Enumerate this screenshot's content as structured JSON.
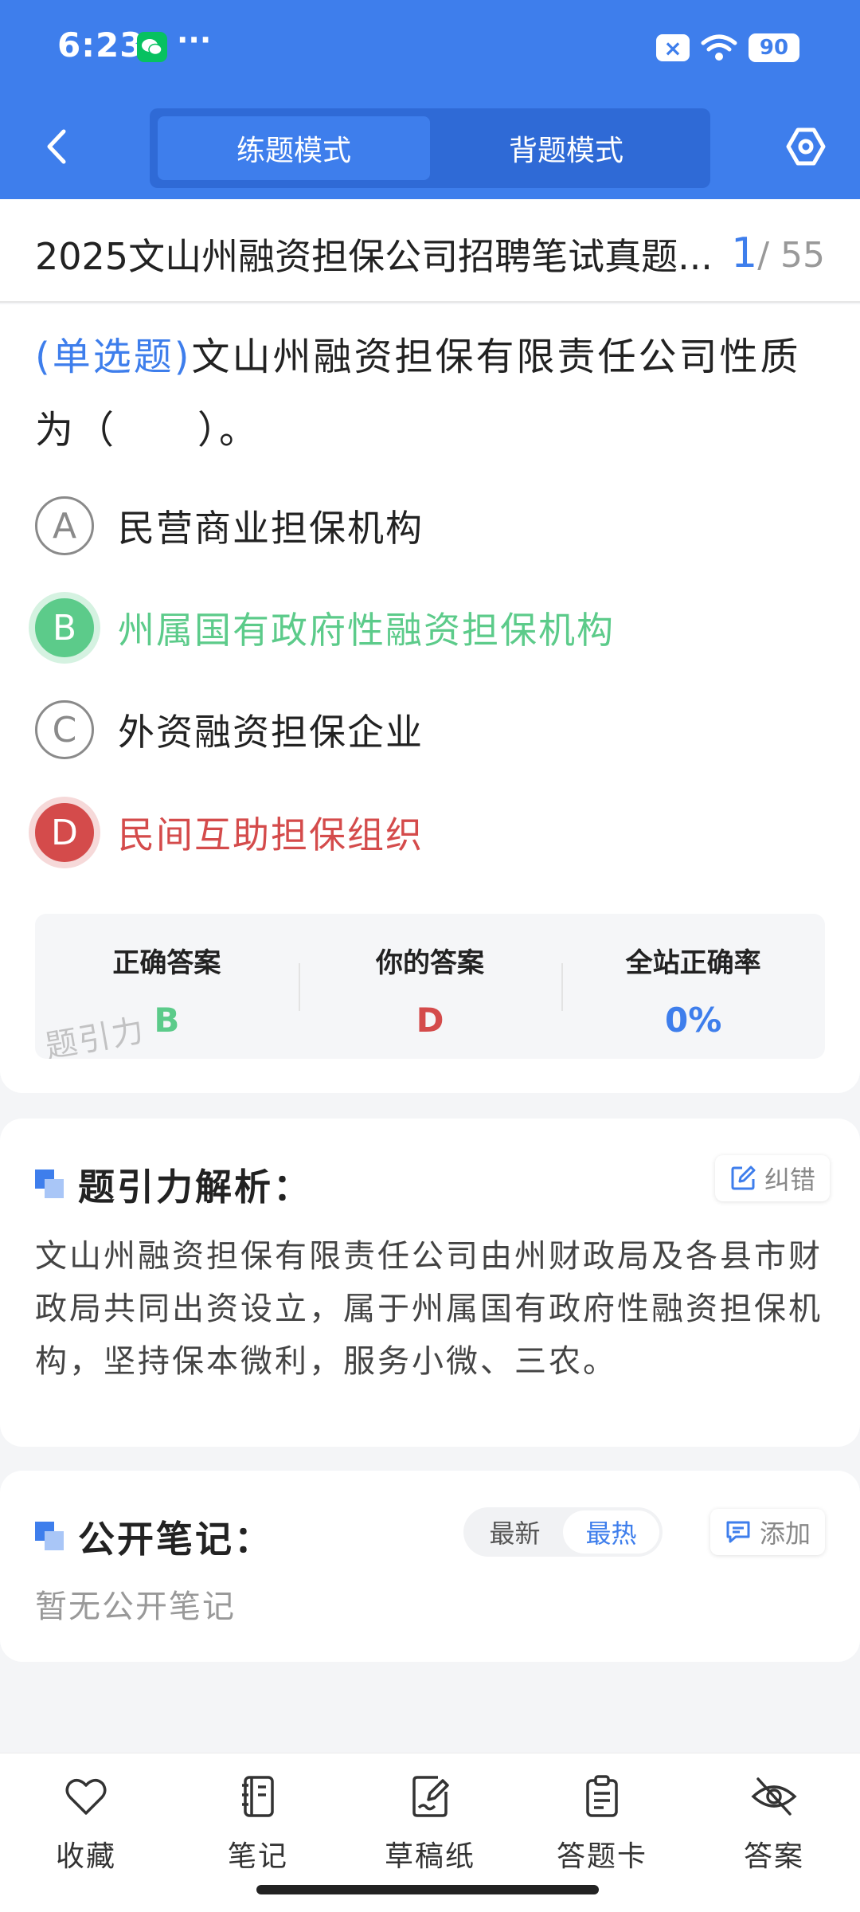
{
  "status_bar": {
    "time": "6:23",
    "more": "···",
    "sim_badge": "×",
    "battery": "90"
  },
  "nav": {
    "modes": [
      {
        "label": "练题模式",
        "active": true
      },
      {
        "label": "背题模式",
        "active": false
      }
    ]
  },
  "title_bar": {
    "title": "2025文山州融资担保公司招聘笔试真题...",
    "current": "1",
    "total": "/ 55"
  },
  "question": {
    "type_label": "(单选题)",
    "text": "文山州融资担保有限责任公司性质为（　　）。",
    "options": [
      {
        "letter": "A",
        "text": "民营商业担保机构",
        "state": "normal"
      },
      {
        "letter": "B",
        "text": "州属国有政府性融资担保机构",
        "state": "correct"
      },
      {
        "letter": "C",
        "text": "外资融资担保企业",
        "state": "normal"
      },
      {
        "letter": "D",
        "text": "民间互助担保组织",
        "state": "wrong"
      }
    ]
  },
  "answer_summary": {
    "correct_label": "正确答案",
    "correct_value": "B",
    "yours_label": "你的答案",
    "yours_value": "D",
    "rate_label": "全站正确率",
    "rate_value": "0%",
    "watermark": "题引力"
  },
  "analysis": {
    "title": "题引力解析：",
    "report_label": "纠错",
    "text": "文山州融资担保有限责任公司由州财政局及各县市财政局共同出资设立，属于州属国有政府性融资担保机构，坚持保本微利，服务小微、三农。"
  },
  "notes": {
    "title": "公开笔记：",
    "sort_options": [
      "最新",
      "最热"
    ],
    "active_sort": "最热",
    "add_label": "添加",
    "empty_text": "暂无公开笔记"
  },
  "bottom_bar": {
    "items": [
      {
        "label": "收藏",
        "icon": "heart-icon"
      },
      {
        "label": "笔记",
        "icon": "notebook-icon"
      },
      {
        "label": "草稿纸",
        "icon": "draft-paper-icon"
      },
      {
        "label": "答题卡",
        "icon": "answer-sheet-icon"
      },
      {
        "label": "答案",
        "icon": "eye-off-icon"
      }
    ]
  },
  "colors": {
    "primary": "#3e7eec",
    "correct": "#5ccb8a",
    "wrong": "#d44b4b"
  }
}
